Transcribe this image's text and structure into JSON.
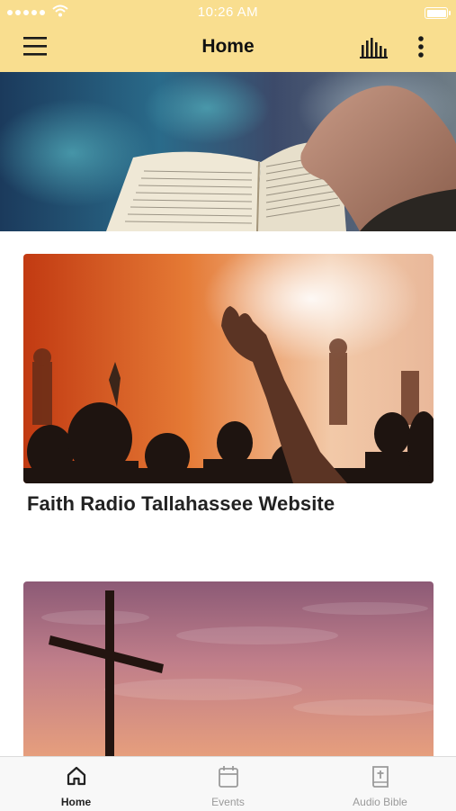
{
  "status_bar": {
    "time": "10:26 AM"
  },
  "header": {
    "title": "Home"
  },
  "cards": [
    {
      "title": "Faith Radio Tallahassee Website"
    },
    {
      "title": ""
    }
  ],
  "tabs": [
    {
      "label": "Home",
      "icon": "home-icon",
      "active": true
    },
    {
      "label": "Events",
      "icon": "calendar-icon",
      "active": false
    },
    {
      "label": "Audio Bible",
      "icon": "bible-icon",
      "active": false
    }
  ],
  "colors": {
    "header_bg": "#f9de8f",
    "tab_active": "#222222",
    "tab_inactive": "#9a9a9a"
  }
}
